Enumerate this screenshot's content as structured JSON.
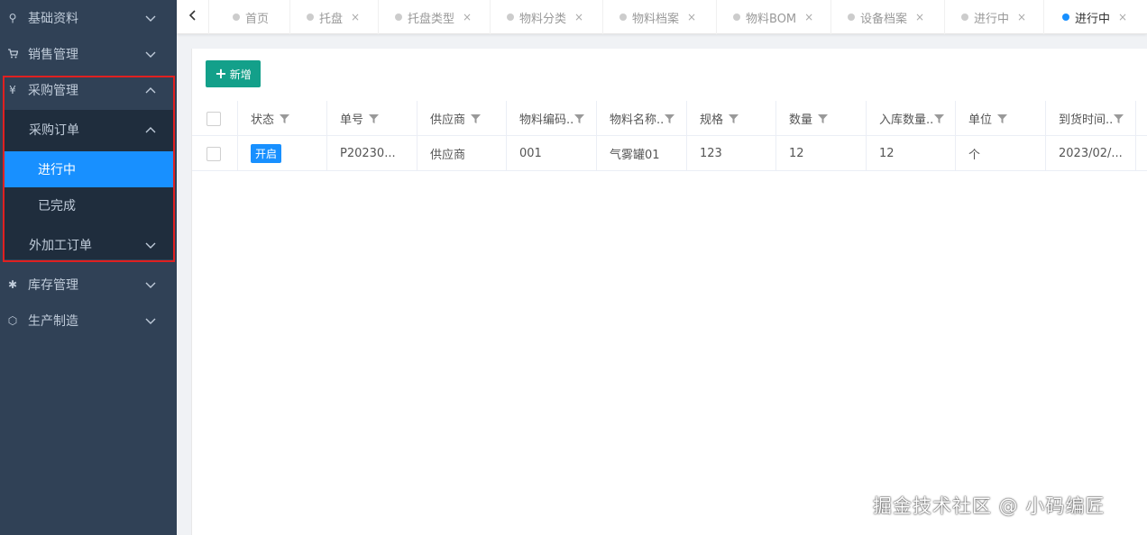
{
  "sidebar": {
    "items": [
      {
        "label": "基础资料",
        "icon": "location-pin-icon"
      },
      {
        "label": "销售管理",
        "icon": "cart-icon"
      },
      {
        "label": "采购管理",
        "icon": "yen-icon"
      },
      {
        "label": "库存管理",
        "icon": "asterisk-icon"
      },
      {
        "label": "生产制造",
        "icon": "hexagon-icon"
      }
    ],
    "sub": {
      "purchase_order": "采购订单",
      "in_progress": "进行中",
      "completed": "已完成",
      "outsource_order": "外加工订单"
    },
    "icon_glyphs": {
      "pin": "⚲",
      "cart": "🛒",
      "yen": "¥",
      "asterisk": "✱",
      "hex": "⬡"
    }
  },
  "tabs": [
    {
      "label": "首页"
    },
    {
      "label": "托盘"
    },
    {
      "label": "托盘类型"
    },
    {
      "label": "物料分类"
    },
    {
      "label": "物料档案"
    },
    {
      "label": "物料BOM"
    },
    {
      "label": "设备档案"
    },
    {
      "label": "进行中"
    },
    {
      "label": "进行中"
    }
  ],
  "tab_close": "×",
  "toolbar": {
    "add_label": "新增",
    "plus": "+"
  },
  "table": {
    "columns": [
      "状态",
      "单号",
      "供应商",
      "物料编码..",
      "物料名称..",
      "规格",
      "数量",
      "入库数量..",
      "单位",
      "到货时间.."
    ],
    "rows": [
      {
        "status": "开启",
        "order_no": "P20230...",
        "supplier": "供应商",
        "material_code": "001",
        "material_name": "气雾罐01",
        "spec": "123",
        "qty": "12",
        "in_qty": "12",
        "unit": "个",
        "arrival": "2023/02/..."
      }
    ]
  },
  "watermark": "掘金技术社区 @ 小码编匠",
  "colors": {
    "sidebar": "#304156",
    "active": "#1890ff",
    "add_button": "#13a08a",
    "highlight": "#e02020"
  }
}
